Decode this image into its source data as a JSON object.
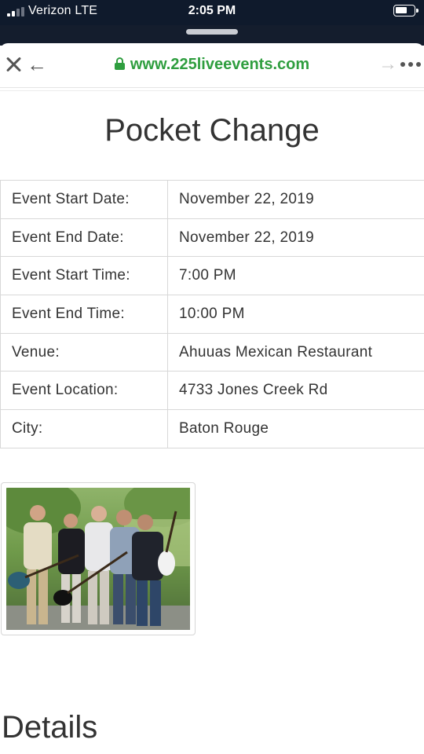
{
  "status_bar": {
    "carrier": "Verizon LTE",
    "time": "2:05 PM"
  },
  "browser": {
    "url": "www.225liveevents.com",
    "url_color": "#2f9e3f"
  },
  "page": {
    "title": "Pocket Change",
    "details_heading": "Details"
  },
  "event_info": [
    {
      "label": "Event Start Date:",
      "value": "November 22, 2019"
    },
    {
      "label": "Event End Date:",
      "value": "November 22, 2019"
    },
    {
      "label": "Event Start Time:",
      "value": "7:00 PM"
    },
    {
      "label": "Event End Time:",
      "value": "10:00 PM"
    },
    {
      "label": "Venue:",
      "value": "Ahuuas Mexican Restaurant"
    },
    {
      "label": "Event Location:",
      "value": "4733 Jones Creek Rd"
    },
    {
      "label": "City:",
      "value": "Baton Rouge"
    }
  ],
  "icons": {
    "close": "close-icon",
    "back": "back-arrow-icon",
    "lock": "lock-icon",
    "forward": "forward-arrow-icon",
    "more": "more-icon"
  }
}
